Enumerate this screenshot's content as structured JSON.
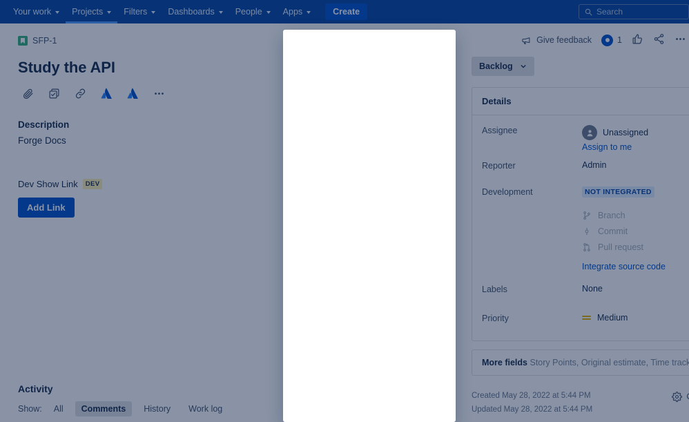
{
  "topnav": {
    "items": [
      {
        "label": "Your work",
        "has_caret": true,
        "active": false
      },
      {
        "label": "Projects",
        "has_caret": true,
        "active": true
      },
      {
        "label": "Filters",
        "has_caret": true,
        "active": false
      },
      {
        "label": "Dashboards",
        "has_caret": true,
        "active": false
      },
      {
        "label": "People",
        "has_caret": true,
        "active": false
      },
      {
        "label": "Apps",
        "has_caret": true,
        "active": false
      }
    ],
    "create_label": "Create",
    "search_placeholder": "Search",
    "background_color": "#0747A6"
  },
  "issue": {
    "breadcrumb_key": "SFP-1",
    "title": "Study the API",
    "actions": [
      {
        "name": "attach-icon",
        "glyph": "📎"
      },
      {
        "name": "child-issue-icon",
        "glyph": "☑"
      },
      {
        "name": "link-issue-icon",
        "glyph": "🔗"
      },
      {
        "name": "forge-app-icon-1",
        "glyph": "▲"
      },
      {
        "name": "forge-app-icon-2",
        "glyph": "▲"
      },
      {
        "name": "more-actions-icon",
        "glyph": "⋯"
      }
    ],
    "description_label": "Description",
    "description_text": "Forge Docs",
    "dev_show_link_label": "Dev Show Link",
    "dev_badge": "DEV",
    "add_link_button": "Add Link"
  },
  "activity": {
    "title": "Activity",
    "show_label": "Show:",
    "filters": [
      {
        "label": "All",
        "selected": false
      },
      {
        "label": "Comments",
        "selected": true
      },
      {
        "label": "History",
        "selected": false
      },
      {
        "label": "Work log",
        "selected": false
      }
    ]
  },
  "right_panel": {
    "give_feedback": "Give feedback",
    "watch_count": "1",
    "status": "Backlog",
    "details_header": "Details",
    "fields": {
      "assignee_label": "Assignee",
      "assignee_value": "Unassigned",
      "assign_to_me": "Assign to me",
      "reporter_label": "Reporter",
      "reporter_value": "Admin",
      "development_label": "Development",
      "development_badge": "NOT INTEGRATED",
      "branch": "Branch",
      "commit": "Commit",
      "pull_request": "Pull request",
      "integrate_source_code": "Integrate source code",
      "labels_label": "Labels",
      "labels_value": "None",
      "priority_label": "Priority",
      "priority_value": "Medium"
    },
    "more_fields_label": "More fields",
    "more_fields_list": "Story Points, Original estimate, Time tracking, Epic Li",
    "created": "Created May 28, 2022 at 5:44 PM",
    "updated": "Updated May 28, 2022 at 5:44 PM",
    "configure_label": "C"
  },
  "colors": {
    "nav_blue": "#0747A6",
    "primary_blue": "#0052CC",
    "story_green": "#36B37E",
    "priority_yellow": "#E2B203",
    "dev_badge_yellow": "#FFF0B3"
  }
}
